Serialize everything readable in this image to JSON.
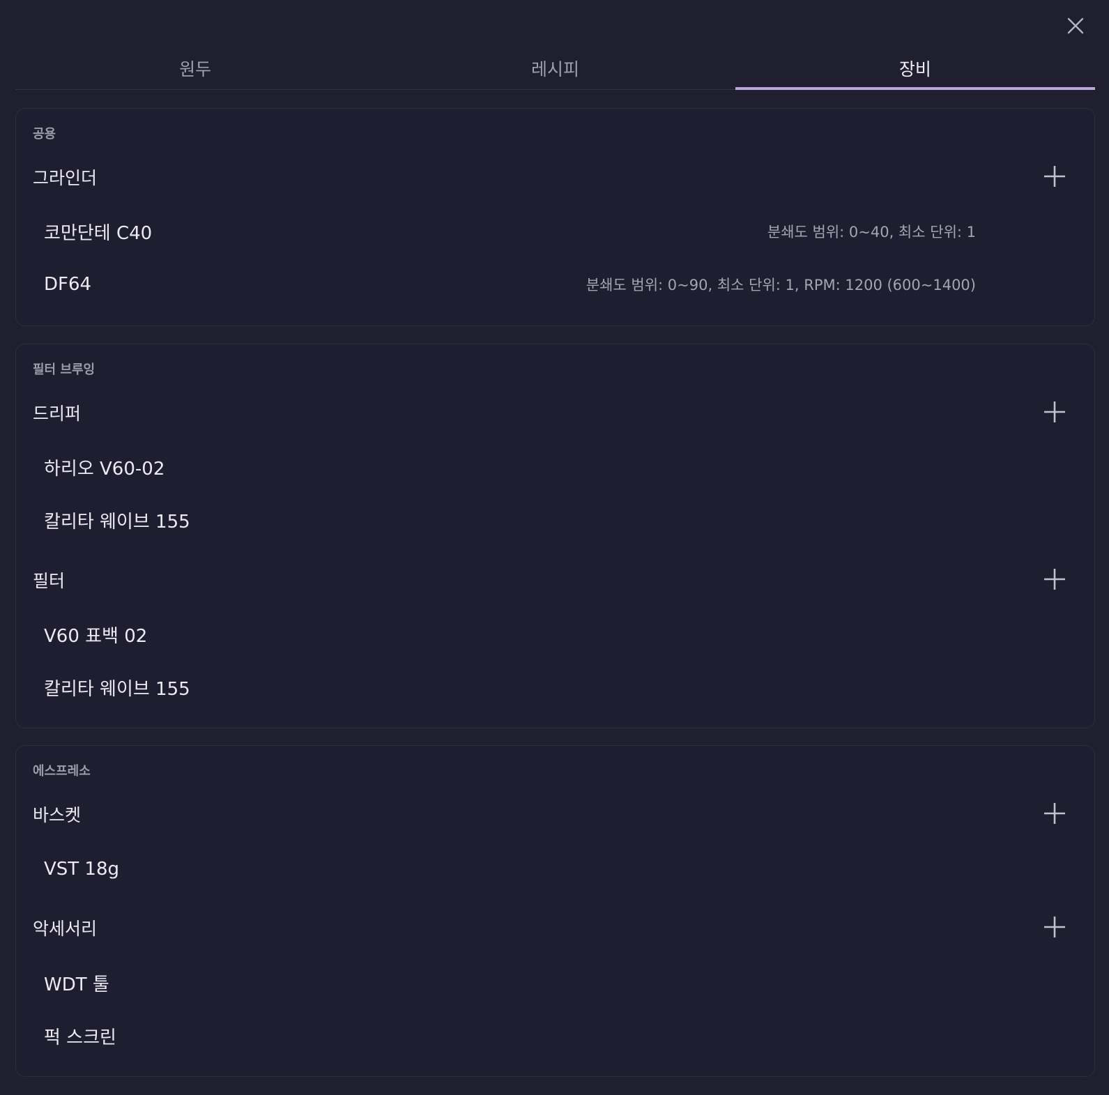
{
  "tabs": [
    {
      "label": "원두",
      "active": false
    },
    {
      "label": "레시피",
      "active": false
    },
    {
      "label": "장비",
      "active": true
    }
  ],
  "colors": {
    "background": "#201f30",
    "accent": "#c0a4dc",
    "text_primary": "#ecebf2",
    "text_secondary": "#a5a4b3"
  },
  "icons": {
    "close": "close-icon",
    "add": "plus-icon"
  },
  "sections": [
    {
      "title": "공용",
      "groups": [
        {
          "title": "그라인더",
          "items": [
            {
              "name": "코만단테 C40",
              "meta": "분쇄도 범위: 0~40, 최소 단위: 1"
            },
            {
              "name": "DF64",
              "meta": "분쇄도 범위: 0~90, 최소 단위: 1, RPM: 1200 (600~1400)"
            }
          ]
        }
      ]
    },
    {
      "title": "필터 브루잉",
      "groups": [
        {
          "title": "드리퍼",
          "items": [
            {
              "name": "하리오 V60-02",
              "meta": ""
            },
            {
              "name": "칼리타 웨이브 155",
              "meta": ""
            }
          ]
        },
        {
          "title": "필터",
          "items": [
            {
              "name": "V60 표백 02",
              "meta": ""
            },
            {
              "name": "칼리타 웨이브 155",
              "meta": ""
            }
          ]
        }
      ]
    },
    {
      "title": "에스프레소",
      "groups": [
        {
          "title": "바스켓",
          "items": [
            {
              "name": "VST 18g",
              "meta": ""
            }
          ]
        },
        {
          "title": "악세서리",
          "items": [
            {
              "name": "WDT 툴",
              "meta": ""
            },
            {
              "name": "퍽 스크린",
              "meta": ""
            }
          ]
        }
      ]
    }
  ]
}
